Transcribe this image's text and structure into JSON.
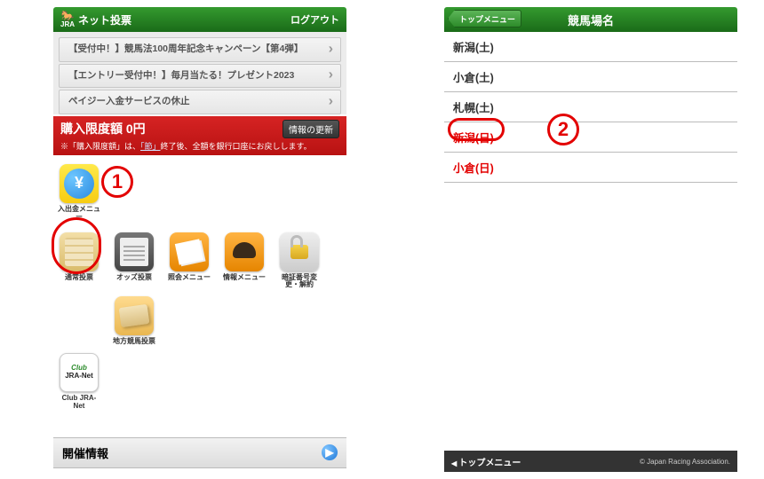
{
  "left": {
    "header": {
      "brand_small": "JRA",
      "title": "ネット投票",
      "logout": "ログアウト"
    },
    "banners": [
      "【受付中！】競馬法100周年記念キャンペーン【第4弾】",
      "【エントリー受付中！】毎月当たる！プレゼント2023",
      "ペイジー入金サービスの休止"
    ],
    "limit": {
      "label": "購入限度額 0円",
      "update_btn": "情報の更新",
      "note_pre": "※「購入限度額」は、",
      "note_link": "「節」",
      "note_post": "終了後、全額を銀行口座にお戻しします。"
    },
    "icons": {
      "deposit": "入出金メニュー",
      "normal": "通常投票",
      "odds": "オッズ投票",
      "results": "照会メニュー",
      "info": "情報メニュー",
      "pin": "暗証番号変更・解約",
      "local": "地方競馬投票",
      "club": "Club JRA-Net",
      "club_line1": "Club",
      "club_line2": "JRA-Net"
    },
    "section": "開催情報"
  },
  "right": {
    "back": "トップメニュー",
    "title": "競馬場名",
    "tracks": [
      "新潟(土)",
      "小倉(土)",
      "札幌(土)",
      "新潟(日)",
      "小倉(日)"
    ],
    "footer": {
      "topmenu": "トップメニュー",
      "copy": "© Japan Racing Association."
    }
  },
  "annot": {
    "one": "1",
    "two": "2"
  }
}
